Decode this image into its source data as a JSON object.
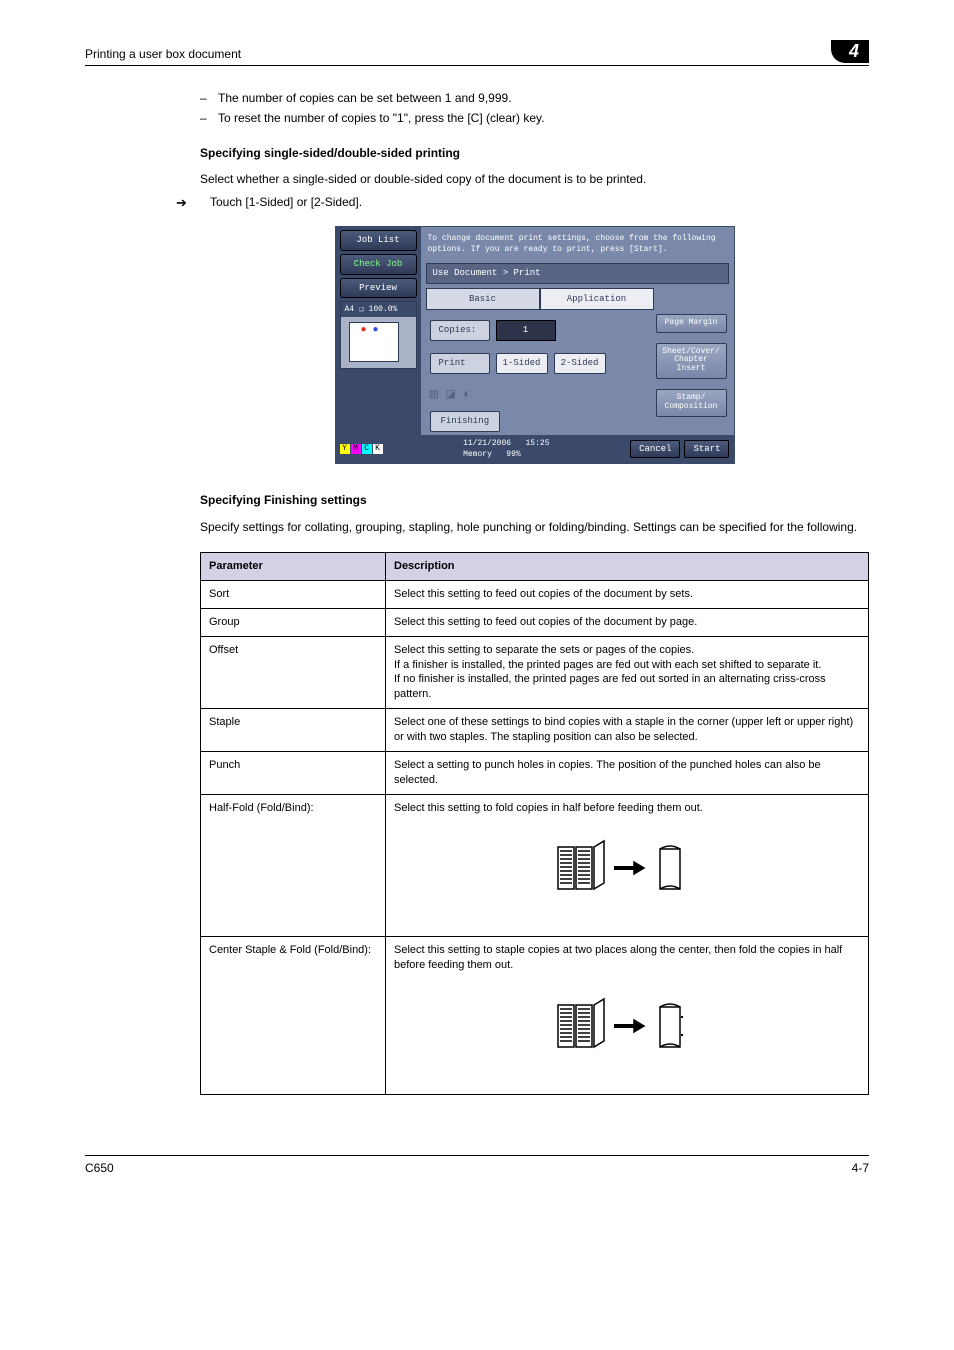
{
  "header": {
    "title": "Printing a user box document",
    "chapter": "4"
  },
  "intro_bullets": [
    "The number of copies can be set between 1 and 9,999.",
    "To reset the number of copies to \"1\", press the [C] (clear) key."
  ],
  "section1": {
    "heading": "Specifying single-sided/double-sided printing",
    "para": "Select whether a single-sided or double-sided copy of the document is to be printed.",
    "step": "Touch [1-Sided] or [2-Sided]."
  },
  "screenshot": {
    "job_list": "Job List",
    "check_job": "Check Job",
    "preview": "Preview",
    "preview_info": "A4 ❏  100.0%",
    "top_msg": "To change document print settings, choose from the following options. If you are ready to print, press [Start].",
    "path": "Use Document > Print",
    "tab_basic": "Basic",
    "tab_application": "Application",
    "copies_label": "Copies:",
    "copies_value": "1",
    "print_label": "Print",
    "opt_1sided": "1-Sided",
    "opt_2sided": "2-Sided",
    "finishing": "Finishing",
    "page_margin": "Page Margin",
    "sheet_cover": "Sheet/Cover/\nChapter Insert",
    "stamp": "Stamp/\nComposition",
    "date": "11/21/2006",
    "time": "15:25",
    "memory": "Memory",
    "memory_pct": "99%",
    "cancel": "Cancel",
    "start": "Start",
    "ymck": [
      "Y",
      "M",
      "C",
      "K"
    ]
  },
  "section2": {
    "heading": "Specifying Finishing settings",
    "para": "Specify settings for collating, grouping, stapling, hole punching or folding/binding. Settings can be specified for the following."
  },
  "table": {
    "head_param": "Parameter",
    "head_desc": "Description",
    "rows": [
      {
        "param": "Sort",
        "desc": "Select this setting to feed out copies of the document by sets."
      },
      {
        "param": "Group",
        "desc": "Select this setting to feed out copies of the document by page."
      },
      {
        "param": "Offset",
        "desc": "Select this setting to separate the sets or pages of the copies.\nIf a finisher is installed, the printed pages are fed out with each set shifted to separate it.\nIf no finisher is installed, the printed pages are fed out sorted in an alternating criss-cross pattern."
      },
      {
        "param": "Staple",
        "desc": "Select one of these settings to bind copies with a staple in the corner (upper left or upper right) or with two staples. The stapling position can also be selected."
      },
      {
        "param": "Punch",
        "desc": "Select a setting to punch holes in copies. The position of the punched holes can also be selected."
      },
      {
        "param": "Half-Fold (Fold/Bind):",
        "desc": "Select this setting to fold copies in half before feeding them out."
      },
      {
        "param": "Center Staple & Fold (Fold/Bind):",
        "desc": "Select this setting to staple copies at two places along the center, then fold the copies in half before feeding them out."
      }
    ]
  },
  "footer": {
    "left": "C650",
    "right": "4-7"
  }
}
